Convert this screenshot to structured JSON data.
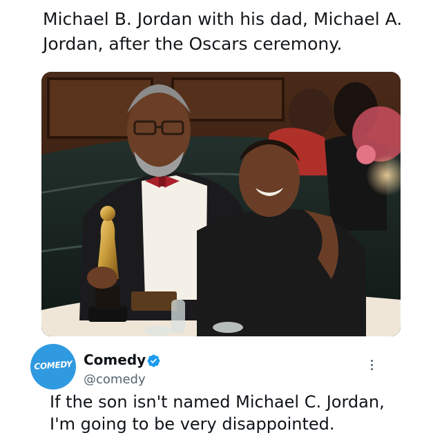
{
  "post": {
    "caption": "Michael B. Jordan with his dad, Michael A. Jordan, after the Oscars ceremony."
  },
  "tweet": {
    "avatar_text": "COMEDY",
    "account_name": "Comedy",
    "handle": "@comedy",
    "verified": true,
    "text_line1": "If the son isn't named Michael C. Jordan,",
    "text_line2": "I'm going to be very disappointed."
  },
  "colors": {
    "verified_badge": "#1d9bf0",
    "avatar_bg": "#2f9ae0",
    "handle_text": "#536471"
  },
  "icons": {
    "verified": "verified-badge-icon",
    "more": "more-options-icon"
  }
}
